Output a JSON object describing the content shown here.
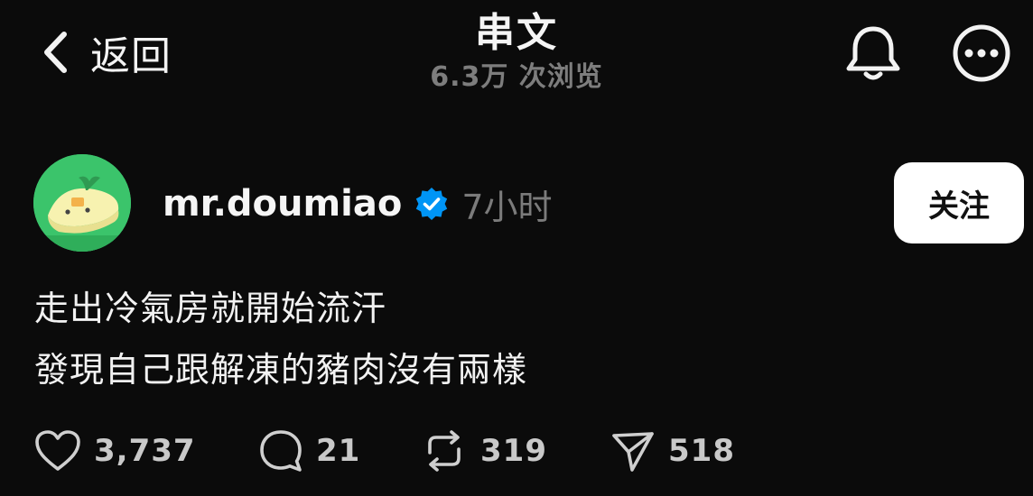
{
  "nav": {
    "back_label": "返回",
    "title": "串文",
    "views": "6.3万 次浏览"
  },
  "post": {
    "username": "mr.doumiao",
    "verified": true,
    "timestamp": "7小时",
    "follow_label": "关注",
    "text_lines": [
      "走出冷氣房就開始流汗",
      "發現自己跟解凍的豬肉沒有兩樣"
    ],
    "actions": {
      "likes": "3,737",
      "replies": "21",
      "reposts": "319",
      "shares": "518"
    }
  },
  "icons": {
    "back": "chevron-left-icon",
    "notifications": "bell-icon",
    "more": "more-horizontal-icon",
    "verified": "verified-badge-icon",
    "like": "heart-icon",
    "reply": "comment-icon",
    "repost": "repost-icon",
    "share": "send-icon"
  },
  "colors": {
    "background": "#0b0b0b",
    "text": "#f3f3f3",
    "muted": "#7b7b7b",
    "verified_blue": "#0095f6",
    "follow_bg": "#ffffff",
    "avatar_bg": "#3bc46b"
  }
}
